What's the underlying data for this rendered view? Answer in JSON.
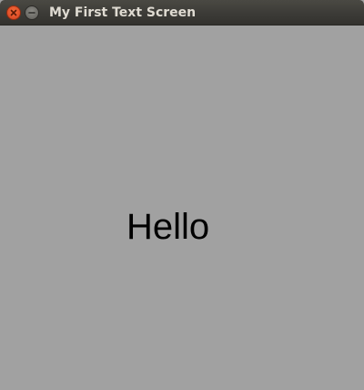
{
  "window": {
    "title": "My First Text Screen"
  },
  "titlebar": {
    "buttons": [
      {
        "icon": "close-icon",
        "color": "#e2512a"
      },
      {
        "icon": "minimize-icon",
        "color": "#6f6e69"
      }
    ]
  },
  "content": {
    "text": "Hello",
    "background": "#a1a1a1",
    "text_color": "#000000"
  }
}
